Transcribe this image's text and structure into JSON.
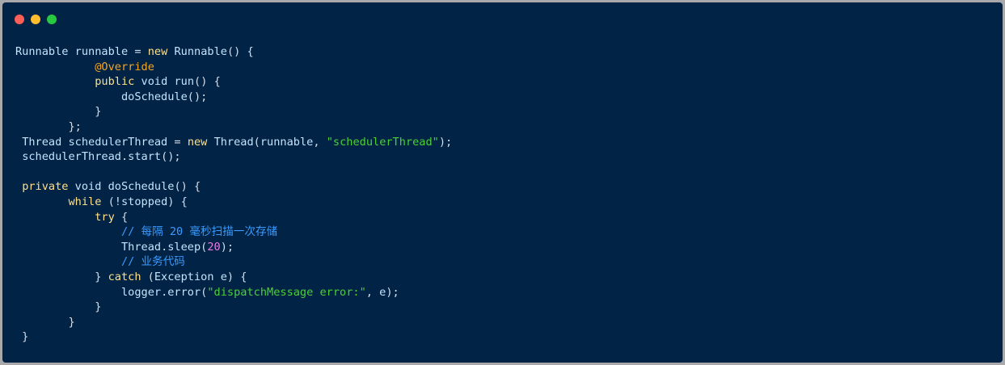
{
  "colors": {
    "background": "#012345",
    "window_close": "#fe5f57",
    "window_minimize": "#febc2e",
    "window_zoom": "#28c840",
    "text": "#d6deeb",
    "keyword": "#ffe08a",
    "annotation": "#f5a623",
    "string": "#4cd036",
    "number": "#e77ee6",
    "comment": "#3a9bff"
  },
  "code": {
    "language": "java",
    "lines": [
      [
        {
          "t": "name",
          "v": "Runnable"
        },
        {
          "t": "plain",
          "v": " "
        },
        {
          "t": "name",
          "v": "runnable"
        },
        {
          "t": "plain",
          "v": " = "
        },
        {
          "t": "keyword",
          "v": "new"
        },
        {
          "t": "plain",
          "v": " "
        },
        {
          "t": "name",
          "v": "Runnable"
        },
        {
          "t": "plain",
          "v": "() {"
        }
      ],
      [
        {
          "t": "plain",
          "v": "            "
        },
        {
          "t": "annotation",
          "v": "@Override"
        }
      ],
      [
        {
          "t": "plain",
          "v": "            "
        },
        {
          "t": "keyword",
          "v": "public"
        },
        {
          "t": "plain",
          "v": " "
        },
        {
          "t": "name",
          "v": "void"
        },
        {
          "t": "plain",
          "v": " "
        },
        {
          "t": "name",
          "v": "run"
        },
        {
          "t": "plain",
          "v": "() {"
        }
      ],
      [
        {
          "t": "plain",
          "v": "                "
        },
        {
          "t": "name",
          "v": "doSchedule"
        },
        {
          "t": "plain",
          "v": "();"
        }
      ],
      [
        {
          "t": "plain",
          "v": "            }"
        }
      ],
      [
        {
          "t": "plain",
          "v": "        };"
        }
      ],
      [
        {
          "t": "plain",
          "v": " "
        },
        {
          "t": "name",
          "v": "Thread"
        },
        {
          "t": "plain",
          "v": " "
        },
        {
          "t": "name",
          "v": "schedulerThread"
        },
        {
          "t": "plain",
          "v": " = "
        },
        {
          "t": "keyword",
          "v": "new"
        },
        {
          "t": "plain",
          "v": " "
        },
        {
          "t": "name",
          "v": "Thread"
        },
        {
          "t": "plain",
          "v": "("
        },
        {
          "t": "name",
          "v": "runnable"
        },
        {
          "t": "plain",
          "v": ", "
        },
        {
          "t": "string",
          "v": "\"schedulerThread\""
        },
        {
          "t": "plain",
          "v": ");"
        }
      ],
      [
        {
          "t": "plain",
          "v": " "
        },
        {
          "t": "name",
          "v": "schedulerThread"
        },
        {
          "t": "plain",
          "v": "."
        },
        {
          "t": "name",
          "v": "start"
        },
        {
          "t": "plain",
          "v": "();"
        }
      ],
      [],
      [
        {
          "t": "plain",
          "v": " "
        },
        {
          "t": "keyword",
          "v": "private"
        },
        {
          "t": "plain",
          "v": " "
        },
        {
          "t": "name",
          "v": "void"
        },
        {
          "t": "plain",
          "v": " "
        },
        {
          "t": "name",
          "v": "doSchedule"
        },
        {
          "t": "plain",
          "v": "() {"
        }
      ],
      [
        {
          "t": "plain",
          "v": "        "
        },
        {
          "t": "keyword",
          "v": "while"
        },
        {
          "t": "plain",
          "v": " (!"
        },
        {
          "t": "name",
          "v": "stopped"
        },
        {
          "t": "plain",
          "v": ") {"
        }
      ],
      [
        {
          "t": "plain",
          "v": "            "
        },
        {
          "t": "keyword",
          "v": "try"
        },
        {
          "t": "plain",
          "v": " {"
        }
      ],
      [
        {
          "t": "plain",
          "v": "                "
        },
        {
          "t": "comment",
          "v": "// 每隔 20 毫秒扫描一次存储"
        }
      ],
      [
        {
          "t": "plain",
          "v": "                "
        },
        {
          "t": "name",
          "v": "Thread"
        },
        {
          "t": "plain",
          "v": "."
        },
        {
          "t": "name",
          "v": "sleep"
        },
        {
          "t": "plain",
          "v": "("
        },
        {
          "t": "number",
          "v": "20"
        },
        {
          "t": "plain",
          "v": ");"
        }
      ],
      [
        {
          "t": "plain",
          "v": "                "
        },
        {
          "t": "comment",
          "v": "// 业务代码"
        }
      ],
      [
        {
          "t": "plain",
          "v": "            } "
        },
        {
          "t": "keyword",
          "v": "catch"
        },
        {
          "t": "plain",
          "v": " ("
        },
        {
          "t": "name",
          "v": "Exception"
        },
        {
          "t": "plain",
          "v": " "
        },
        {
          "t": "name",
          "v": "e"
        },
        {
          "t": "plain",
          "v": ") {"
        }
      ],
      [
        {
          "t": "plain",
          "v": "                "
        },
        {
          "t": "name",
          "v": "logger"
        },
        {
          "t": "plain",
          "v": "."
        },
        {
          "t": "name",
          "v": "error"
        },
        {
          "t": "plain",
          "v": "("
        },
        {
          "t": "string",
          "v": "\"dispatchMessage error:\""
        },
        {
          "t": "plain",
          "v": ", "
        },
        {
          "t": "name",
          "v": "e"
        },
        {
          "t": "plain",
          "v": ");"
        }
      ],
      [
        {
          "t": "plain",
          "v": "            }"
        }
      ],
      [
        {
          "t": "plain",
          "v": "        }"
        }
      ],
      [
        {
          "t": "plain",
          "v": " }"
        }
      ]
    ]
  }
}
